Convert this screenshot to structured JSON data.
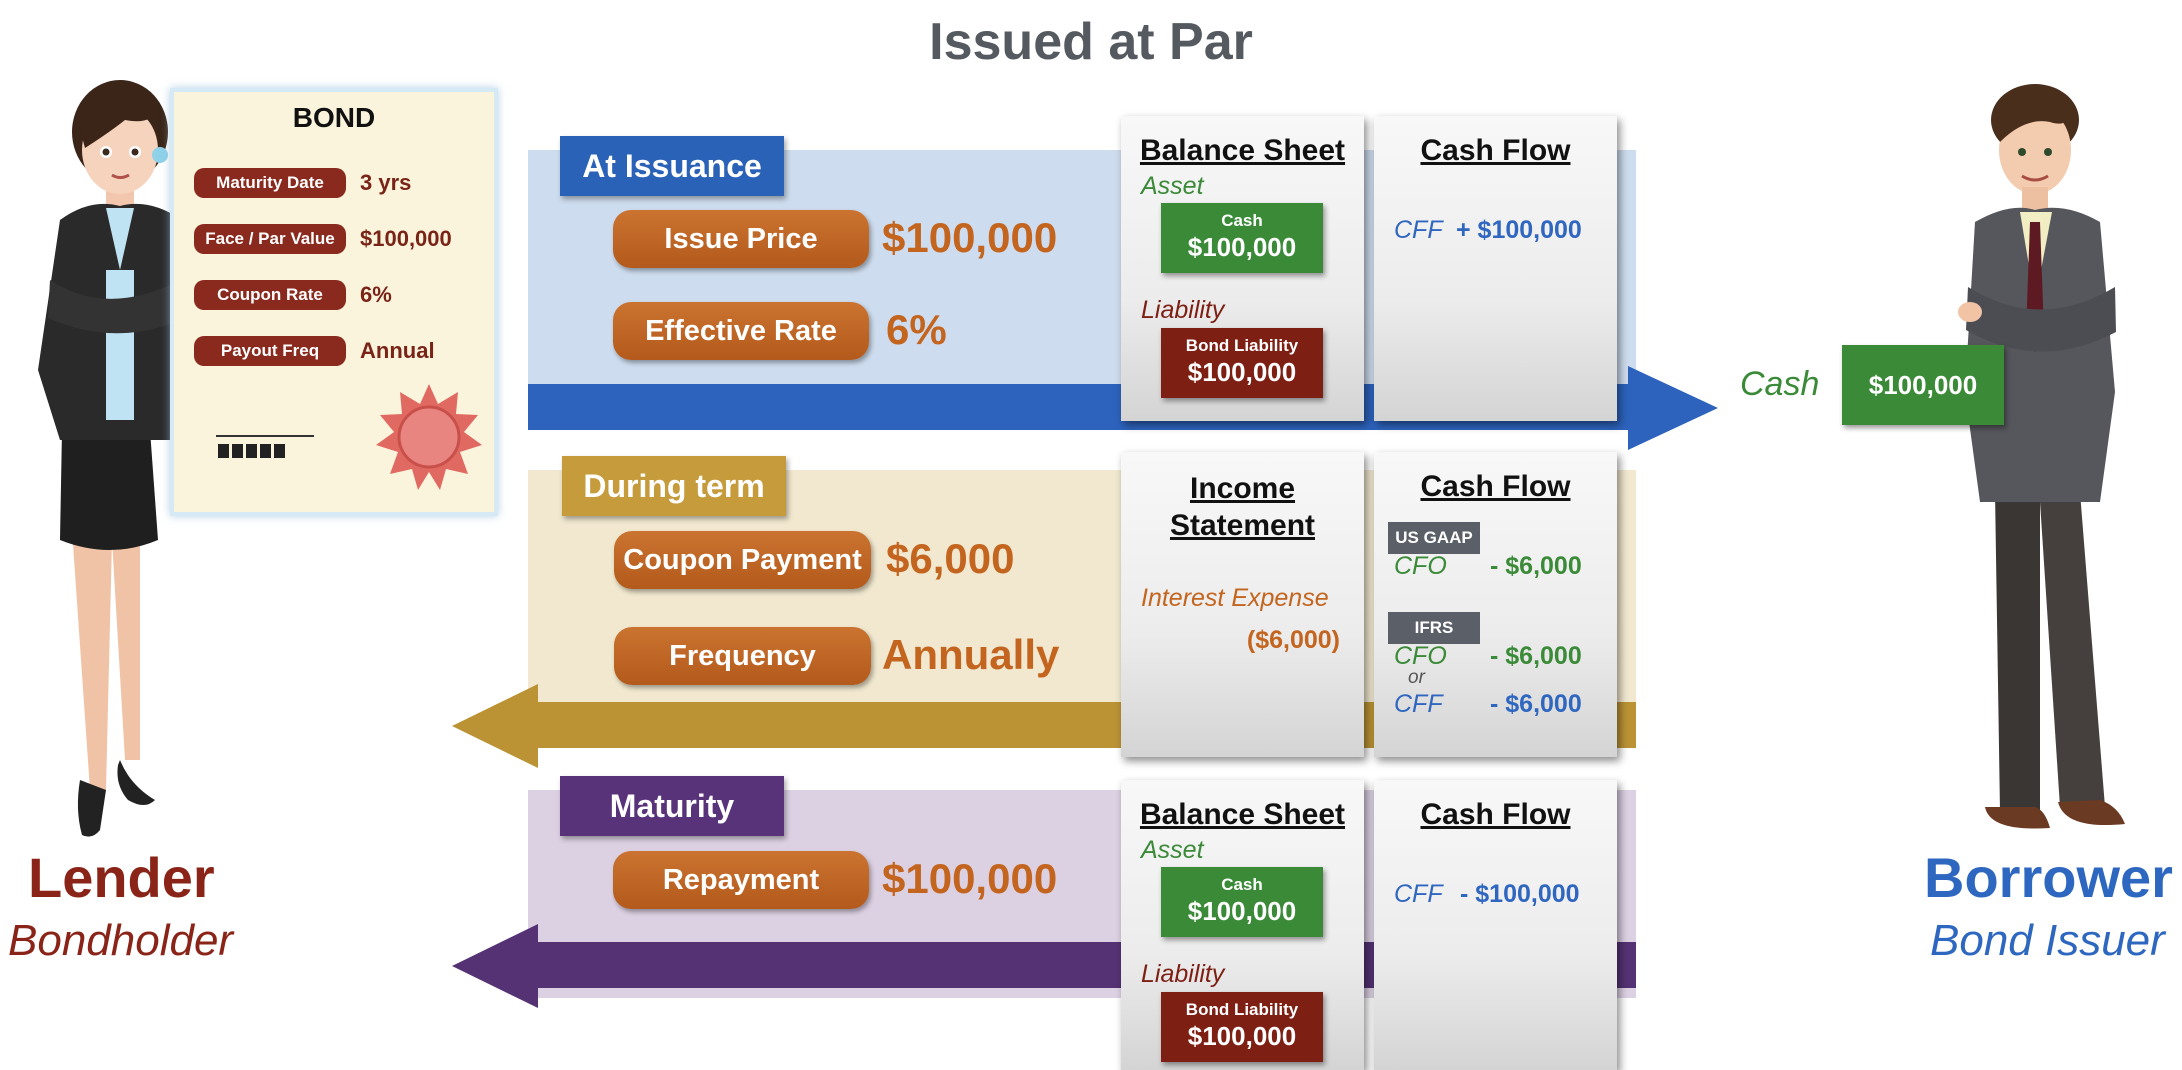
{
  "title": "Issued at Par",
  "lender": {
    "name": "Lender",
    "subtitle": "Bondholder"
  },
  "borrower": {
    "name": "Borrower",
    "subtitle": "Bond Issuer"
  },
  "bond": {
    "heading": "BOND",
    "rows": [
      {
        "label": "Maturity Date",
        "value": "3 yrs"
      },
      {
        "label": "Face / Par Value",
        "value": "$100,000"
      },
      {
        "label": "Coupon Rate",
        "value": "6%"
      },
      {
        "label": "Payout Freq",
        "value": "Annual"
      }
    ]
  },
  "issuance": {
    "label": "At Issuance",
    "items": [
      {
        "label": "Issue Price",
        "value": "$100,000"
      },
      {
        "label": "Effective Rate",
        "value": "6%"
      }
    ],
    "balance_sheet": {
      "heading": "Balance Sheet",
      "asset_label": "Asset",
      "asset_box": {
        "label": "Cash",
        "value": "$100,000"
      },
      "liability_label": "Liability",
      "liability_box": {
        "label": "Bond Liability",
        "value": "$100,000"
      }
    },
    "cash_flow": {
      "heading": "Cash Flow",
      "line": {
        "type": "CFF",
        "amount": "+ $100,000"
      }
    },
    "transfer": {
      "label": "Cash",
      "value": "$100,000"
    }
  },
  "during": {
    "label": "During term",
    "items": [
      {
        "label": "Coupon Payment",
        "value": "$6,000"
      },
      {
        "label": "Frequency",
        "value": "Annually"
      }
    ],
    "income_statement": {
      "heading_1": "Income",
      "heading_2": "Statement",
      "line_label": "Interest Expense",
      "line_value": "($6,000)"
    },
    "cash_flow": {
      "heading": "Cash Flow",
      "us_gaap": {
        "badge": "US GAAP",
        "type": "CFO",
        "amount": "- $6,000"
      },
      "ifrs": {
        "badge": "IFRS",
        "type_1": "CFO",
        "amount_1": "- $6,000",
        "or": "or",
        "type_2": "CFF",
        "amount_2": "- $6,000"
      }
    }
  },
  "maturity": {
    "label": "Maturity",
    "items": [
      {
        "label": "Repayment",
        "value": "$100,000"
      }
    ],
    "balance_sheet": {
      "heading": "Balance Sheet",
      "asset_label": "Asset",
      "asset_box": {
        "label": "Cash",
        "value": "$100,000"
      },
      "liability_label": "Liability",
      "liability_box": {
        "label": "Bond Liability",
        "value": "$100,000"
      }
    },
    "cash_flow": {
      "heading": "Cash Flow",
      "line": {
        "type": "CFF",
        "amount": "- $100,000"
      }
    }
  },
  "colors": {
    "issuance_band": "#cddcee",
    "issuance_arrow": "#2d63bd",
    "issuance_label": "#2a62b7",
    "during_band": "#f1e8cf",
    "during_arrow": "#bb9335",
    "during_label": "#c59b3b",
    "maturity_band": "#dcd1e3",
    "maturity_arrow": "#553274",
    "maturity_label": "#58337a",
    "asset_green": "#3a8a38",
    "liability_red": "#7e1f14",
    "cff_blue": "#2f66c0",
    "cfo_green": "#3a8a38"
  }
}
